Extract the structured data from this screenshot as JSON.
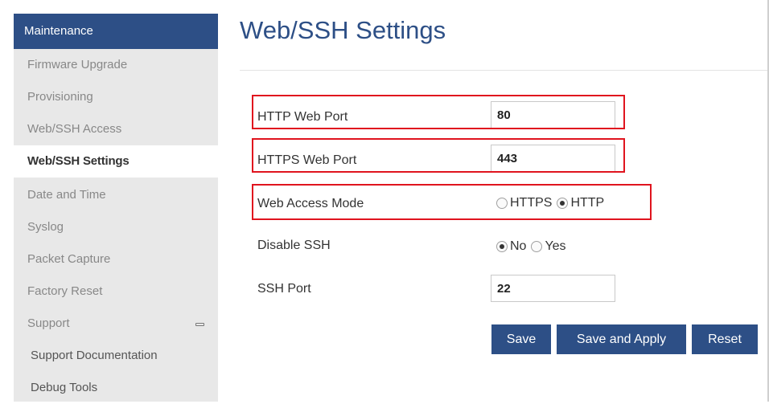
{
  "sidebar": {
    "header": "Maintenance",
    "items": [
      {
        "label": "Firmware Upgrade"
      },
      {
        "label": "Provisioning"
      },
      {
        "label": "Web/SSH Access"
      },
      {
        "label": "Web/SSH Settings",
        "active": true
      },
      {
        "label": "Date and Time"
      },
      {
        "label": "Syslog"
      },
      {
        "label": "Packet Capture"
      },
      {
        "label": "Factory Reset"
      },
      {
        "label": "Support",
        "expandable": true
      },
      {
        "label": "Support Documentation"
      },
      {
        "label": "Debug Tools"
      }
    ]
  },
  "main": {
    "title": "Web/SSH Settings",
    "fields": {
      "http_port": {
        "label": "HTTP Web Port",
        "value": "80"
      },
      "https_port": {
        "label": "HTTPS Web Port",
        "value": "443"
      },
      "access_mode": {
        "label": "Web Access Mode",
        "options": [
          "HTTPS",
          "HTTP"
        ],
        "selected": "HTTP"
      },
      "disable_ssh": {
        "label": "Disable SSH",
        "options": [
          "No",
          "Yes"
        ],
        "selected": "No"
      },
      "ssh_port": {
        "label": "SSH Port",
        "value": "22"
      }
    },
    "buttons": {
      "save": "Save",
      "save_apply": "Save and Apply",
      "reset": "Reset"
    }
  },
  "colors": {
    "accent": "#2d4f86",
    "highlight": "#e0141e",
    "sidebar_bg": "#e8e8e8"
  }
}
